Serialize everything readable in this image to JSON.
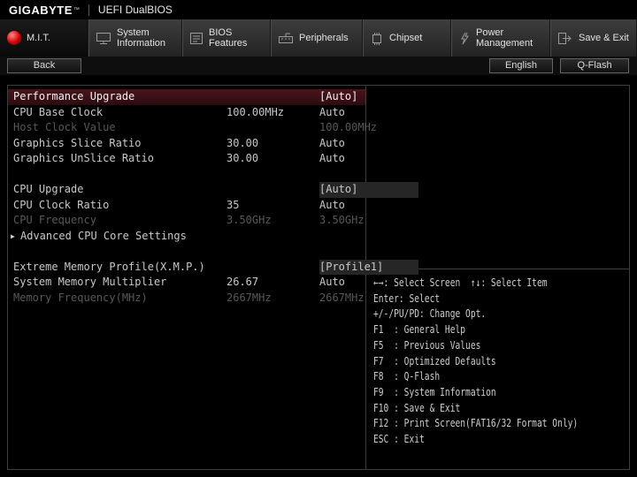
{
  "titlebar": {
    "brand": "GIGABYTE",
    "trademark": "™",
    "title": "UEFI DualBIOS"
  },
  "tabs": [
    {
      "label": "M.I.T.",
      "icon": "red-sphere-icon",
      "active": true
    },
    {
      "label": "System\nInformation",
      "icon": "monitor-icon",
      "active": false
    },
    {
      "label": "BIOS\nFeatures",
      "icon": "bios-list-icon",
      "active": false
    },
    {
      "label": "Peripherals",
      "icon": "peripherals-icon",
      "active": false
    },
    {
      "label": "Chipset",
      "icon": "chipset-icon",
      "active": false
    },
    {
      "label": "Power\nManagement",
      "icon": "power-icon",
      "active": false
    },
    {
      "label": "Save & Exit",
      "icon": "save-exit-icon",
      "active": false
    }
  ],
  "toolbar": {
    "back_label": "Back",
    "language_label": "English",
    "qflash_label": "Q-Flash"
  },
  "settings": {
    "rows": [
      {
        "label": "Performance Upgrade",
        "mid": "",
        "value": "[Auto]",
        "state": "selected"
      },
      {
        "label": "CPU Base Clock",
        "mid": "100.00MHz",
        "value": "Auto",
        "state": "normal"
      },
      {
        "label": "Host Clock Value",
        "mid": "",
        "value": "100.00MHz",
        "state": "disabled"
      },
      {
        "label": "Graphics Slice Ratio",
        "mid": "30.00",
        "value": "Auto",
        "state": "normal"
      },
      {
        "label": "Graphics UnSlice Ratio",
        "mid": "30.00",
        "value": "Auto",
        "state": "normal"
      },
      {
        "label": "CPU Upgrade",
        "mid": "",
        "value": "[Auto]",
        "state": "normal",
        "boxed": true
      },
      {
        "label": "CPU Clock Ratio",
        "mid": "35",
        "value": "Auto",
        "state": "normal"
      },
      {
        "label": "CPU Frequency",
        "mid": "3.50GHz",
        "value": "3.50GHz",
        "state": "disabled"
      },
      {
        "label": "Advanced CPU Core Settings",
        "mid": "",
        "value": "",
        "state": "normal",
        "submenu": true
      },
      {
        "label": "Extreme Memory Profile(X.M.P.)",
        "mid": "",
        "value": "[Profile1]",
        "state": "normal",
        "boxed": true
      },
      {
        "label": "System Memory Multiplier",
        "mid": "26.67",
        "value": "Auto",
        "state": "normal"
      },
      {
        "label": "Memory Frequency(MHz)",
        "mid": "2667MHz",
        "value": "2667MHz",
        "state": "disabled"
      }
    ],
    "submenu_arrow": "▶"
  },
  "help": {
    "lines": [
      "←→: Select Screen  ↑↓: Select Item",
      "Enter: Select",
      "+/-/PU/PD: Change Opt.",
      "F1  : General Help",
      "F5  : Previous Values",
      "F7  : Optimized Defaults",
      "F8  : Q-Flash",
      "F9  : System Information",
      "F10 : Save & Exit",
      "F12 : Print Screen(FAT16/32 Format Only)",
      "ESC : Exit"
    ]
  },
  "colors": {
    "accent_red": "#d40000",
    "selected_row_bg": "#3d1118",
    "disabled_text": "#585858",
    "panel_border": "#3e3e3e"
  }
}
